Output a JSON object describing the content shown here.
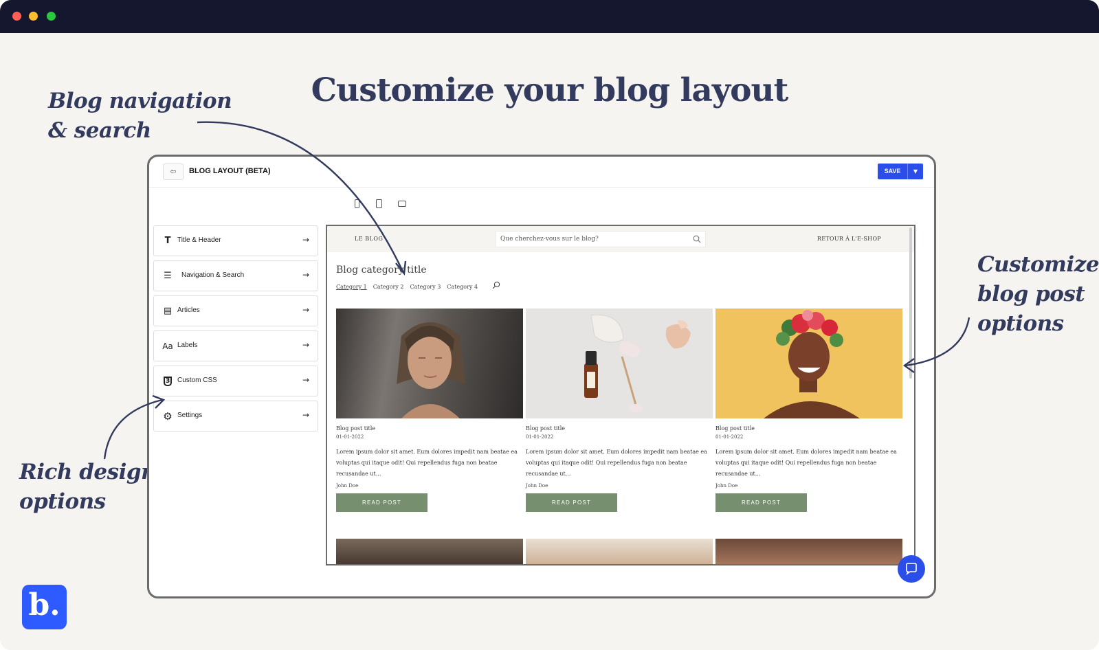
{
  "headline": "Customize your blog layout",
  "annotations": {
    "nav_search": [
      "Blog navigation",
      "& search"
    ],
    "post_options": [
      "Customize",
      "blog post",
      "options"
    ],
    "design_options": [
      "Rich design",
      "options"
    ]
  },
  "logo_text": "b.",
  "app": {
    "title": "BLOG LAYOUT (BETA)",
    "save_label": "SAVE",
    "devices": [
      "phone-icon",
      "tablet-icon",
      "desktop-icon"
    ],
    "sidebar": [
      {
        "icon": "text-t-icon",
        "glyph": "T",
        "label": "Title & Header"
      },
      {
        "icon": "list-icon",
        "glyph": "☰",
        "label": "Navigation & Search"
      },
      {
        "icon": "article-icon",
        "glyph": "▤",
        "label": "Articles"
      },
      {
        "icon": "font-aa-icon",
        "glyph": "Aa",
        "label": "Labels"
      },
      {
        "icon": "css-icon",
        "glyph": "3",
        "label": "Custom CSS"
      },
      {
        "icon": "gear-icon",
        "glyph": "⚙",
        "label": "Settings"
      }
    ]
  },
  "preview": {
    "brand": "LE BLOG",
    "search_placeholder": "Que cherchez-vous sur le blog?",
    "back_link": "RETOUR À L'E-SHOP",
    "category_title": "Blog category title",
    "categories": [
      "Category 1",
      "Category 2",
      "Category 3",
      "Category 4"
    ],
    "posts": [
      {
        "title": "Blog post title",
        "date": "01-01-2022",
        "excerpt": "Lorem ipsum dolor sit amet. Eum dolores impedit nam beatae ea voluptas qui itaque odit! Qui repellendus fuga non beatae recusandae ut...",
        "author": "John Doe",
        "button": "READ POST"
      },
      {
        "title": "Blog post title",
        "date": "01-01-2022",
        "excerpt": "Lorem ipsum dolor sit amet. Eum dolores impedit nam beatae ea voluptas qui itaque odit! Qui repellendus fuga non beatae recusandae ut...",
        "author": "John Doe",
        "button": "READ POST"
      },
      {
        "title": "Blog post title",
        "date": "01-01-2022",
        "excerpt": "Lorem ipsum dolor sit amet. Eum dolores impedit nam beatae ea voluptas qui itaque odit! Qui repellendus fuga non beatae recusandae ut...",
        "author": "John Doe",
        "button": "READ POST"
      }
    ]
  },
  "colors": {
    "brand_blue": "#2d5bff",
    "save_blue": "#2c4ee8",
    "button_green": "#76906f",
    "headline_navy": "#323a5e",
    "titlebar": "#15172e"
  }
}
